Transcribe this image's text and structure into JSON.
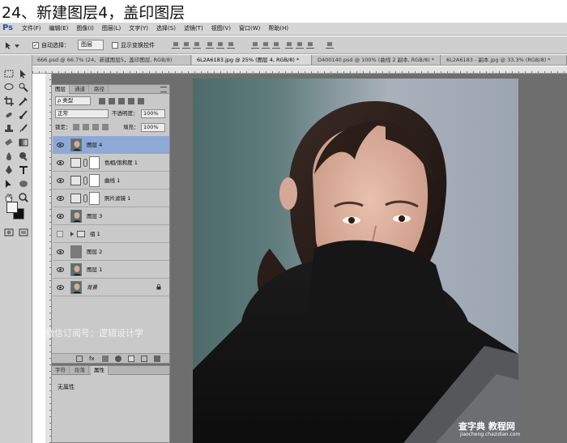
{
  "caption": "24、新建图层4，盖印图层",
  "menu": {
    "logo": "Ps",
    "items": [
      "文件(F)",
      "编辑(E)",
      "图像(I)",
      "图层(L)",
      "文字(Y)",
      "选择(S)",
      "滤镜(T)",
      "视图(V)",
      "窗口(W)",
      "帮助(H)"
    ]
  },
  "options": {
    "auto_select_label": "自动选择：",
    "auto_select_value": "图层",
    "show_transform_label": "显示变换控件"
  },
  "doc_tabs": [
    "666.psd @ 66.7% (24、新建图层5，盖印图层, RGB/8)",
    "6L2A6183.jpg @ 25% (图层 4, RGB/8) *",
    "D400140.psd @ 100% (曲线 2 副本, RGB/8) *",
    "6L2A6183 - 副本.jpg @ 33.3% (RGB/8) *"
  ],
  "layers_panel": {
    "tabs": [
      "图层",
      "通道",
      "路径"
    ],
    "filter_label": "类型",
    "blend_mode": "正常",
    "opacity_label": "不透明度：",
    "opacity_value": "100%",
    "lock_label": "锁定：",
    "fill_label": "填充：",
    "fill_value": "100%",
    "layers": [
      {
        "name": "图层 4",
        "kind": "photo",
        "visible": true,
        "selected": true
      },
      {
        "name": "色相/饱和度 1",
        "kind": "adjustment-hue",
        "visible": true,
        "selected": false
      },
      {
        "name": "曲线 1",
        "kind": "adjustment-curves",
        "visible": true,
        "selected": false
      },
      {
        "name": "照片滤镜 1",
        "kind": "adjustment-filter",
        "visible": true,
        "selected": false
      },
      {
        "name": "图层 3",
        "kind": "photo",
        "visible": true,
        "selected": false
      },
      {
        "name": "组 1",
        "kind": "group",
        "visible": false,
        "selected": false
      },
      {
        "name": "图层 2",
        "kind": "gray",
        "visible": true,
        "selected": false
      },
      {
        "name": "图层 1",
        "kind": "photo",
        "visible": true,
        "selected": false
      },
      {
        "name": "背景",
        "kind": "background",
        "visible": true,
        "selected": false
      }
    ]
  },
  "watermark_text": "微信订阅号：逻辑设计学",
  "props_panel": {
    "tabs": [
      "字符",
      "段落",
      "属性"
    ],
    "body": "无属性"
  },
  "site_watermark": {
    "line1": "查字典 教程网",
    "line2": "jiaocheng.chazidian.com"
  },
  "colors": {
    "selected_layer": "#8fa9d6",
    "panel_bg": "#c9c9c9",
    "canvas_bg": "#6e6e6e"
  }
}
